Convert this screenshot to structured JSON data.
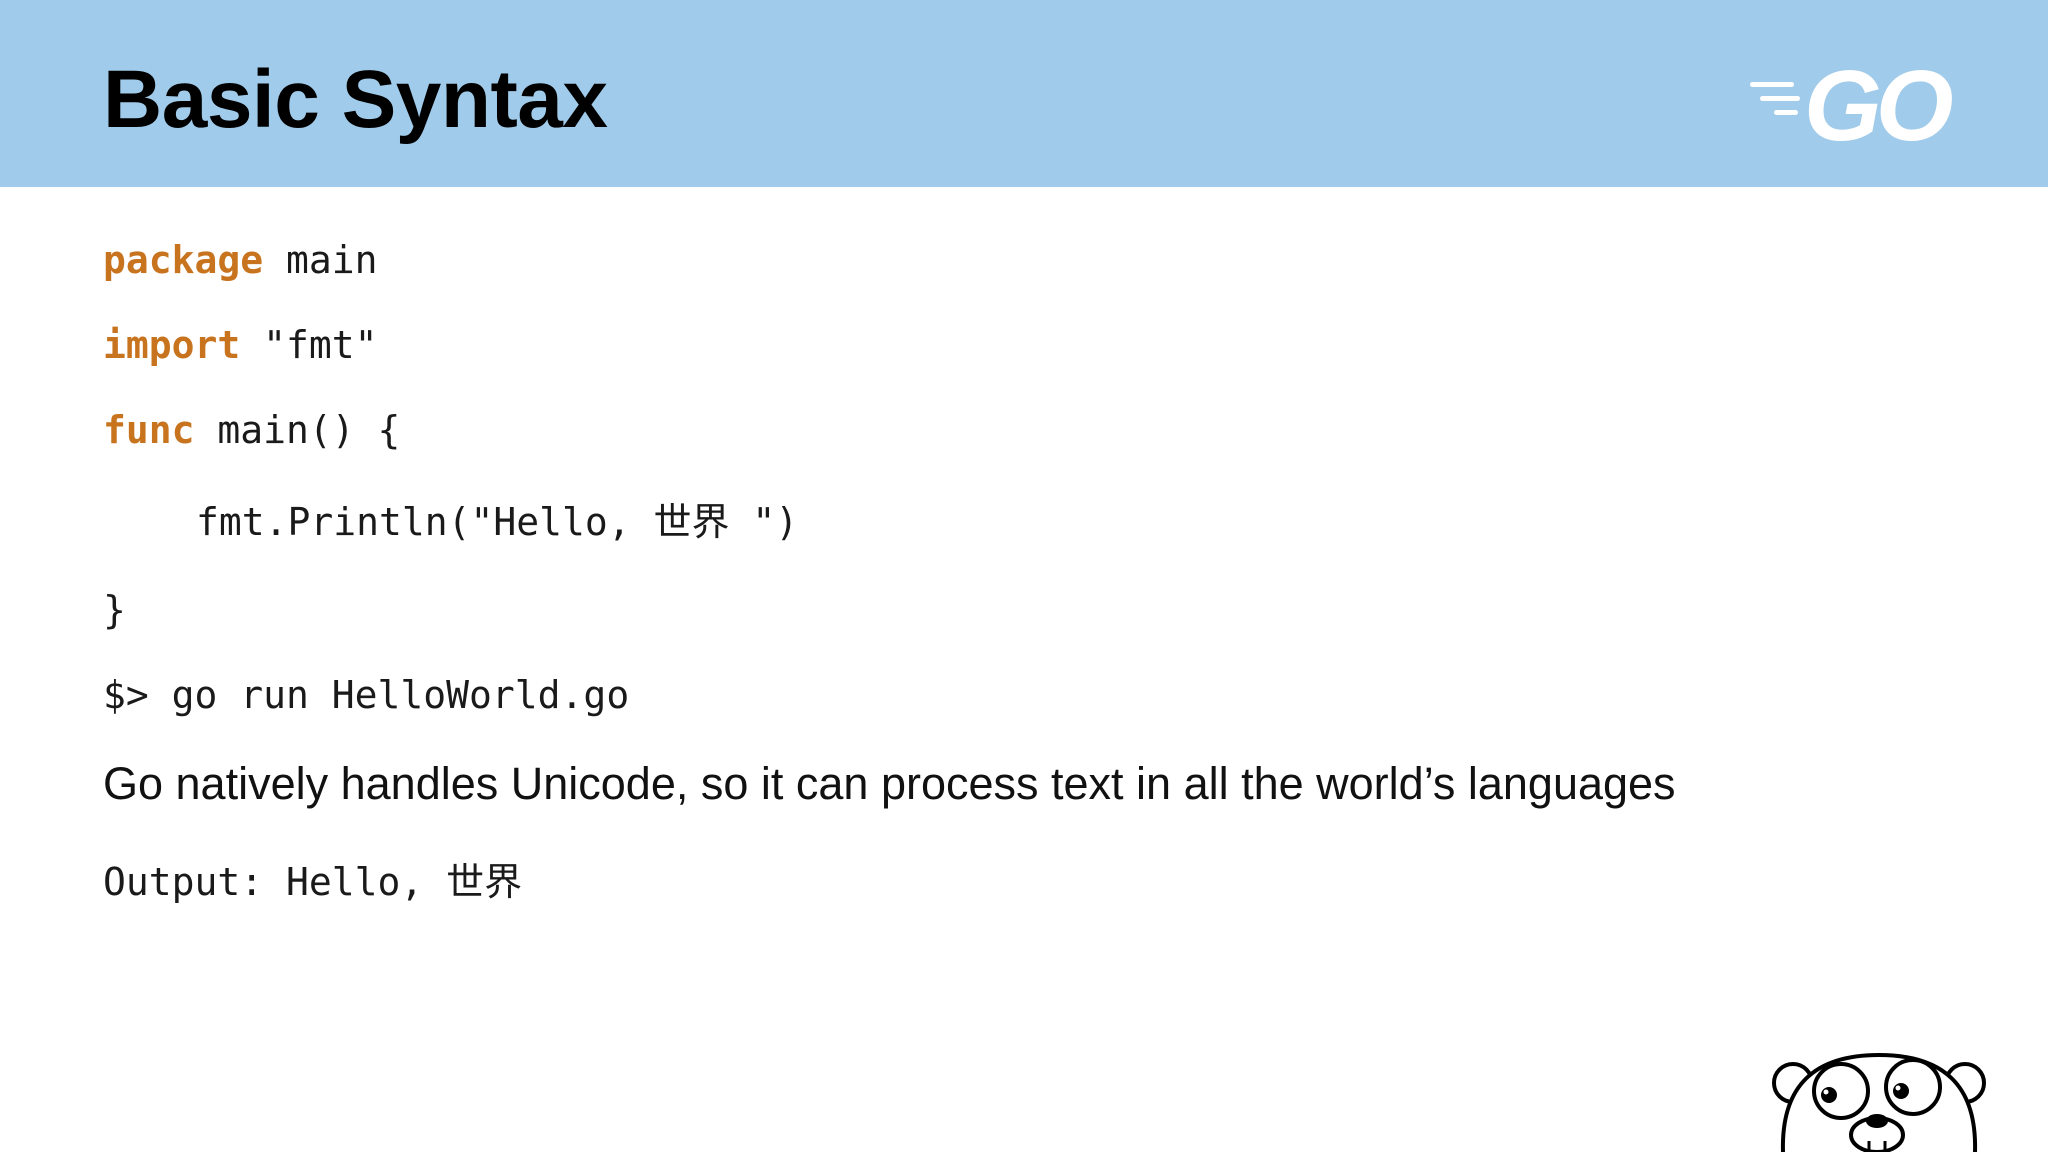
{
  "slide": {
    "title": "Basic Syntax",
    "logo_text": "GO",
    "code": {
      "line1": {
        "keyword": "package",
        "rest": " main"
      },
      "line2": {
        "keyword": "import",
        "rest": " \"fmt\""
      },
      "line3": {
        "keyword": "func",
        "rest": " main() {"
      },
      "line4": {
        "text": "fmt.Println(\"Hello, 世界 \")"
      },
      "line5": {
        "text": "}"
      }
    },
    "command": "$> go run HelloWorld.go",
    "description": "Go natively handles Unicode, so it can process text in all the world’s languages",
    "output": "Output: Hello, 世界"
  },
  "colors": {
    "header_background": "#a0cbea",
    "keyword": "#c8741f",
    "logo": "#ffffff"
  },
  "icons": {
    "logo": "go-logo-icon",
    "mascot": "gopher-mascot-icon"
  }
}
